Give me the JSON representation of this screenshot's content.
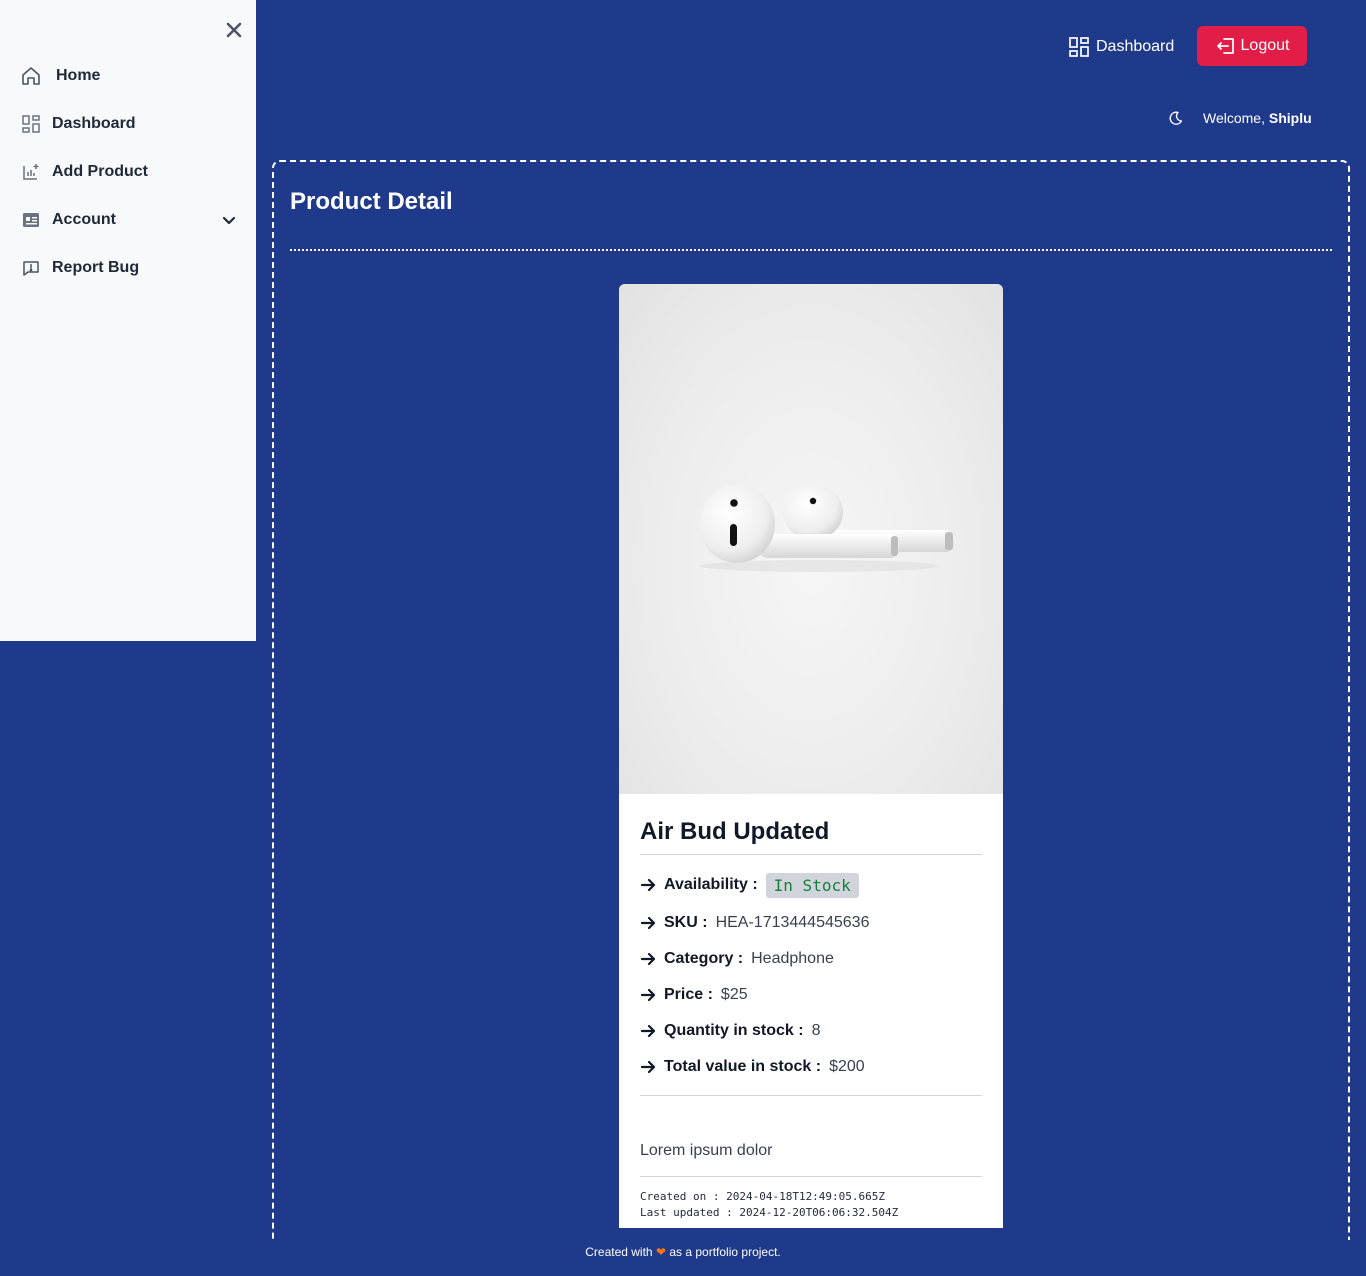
{
  "sidebar": {
    "items": [
      {
        "label": "Home",
        "icon": "home-icon"
      },
      {
        "label": "Dashboard",
        "icon": "grid-icon"
      },
      {
        "label": "Add Product",
        "icon": "add-chart-icon"
      },
      {
        "label": "Account",
        "icon": "account-card-icon"
      },
      {
        "label": "Report Bug",
        "icon": "message-alert-icon"
      }
    ]
  },
  "header": {
    "dashboard_label": "Dashboard",
    "logout_label": "Logout",
    "welcome_prefix": "Welcome,",
    "username": "Shiplu"
  },
  "page": {
    "title": "Product Detail"
  },
  "product": {
    "name": "Air Bud Updated",
    "fields": [
      {
        "label": "Availability :",
        "value": "In Stock"
      },
      {
        "label": "SKU :",
        "value": "HEA-1713444545636"
      },
      {
        "label": "Category :",
        "value": "Headphone"
      },
      {
        "label": "Price :",
        "value": "$25"
      },
      {
        "label": "Quantity in stock :",
        "value": "8"
      },
      {
        "label": "Total value in stock :",
        "value": "$200"
      }
    ],
    "description": "Lorem ipsum dolor",
    "created": "Created on : 2024-04-18T12:49:05.665Z",
    "updated": "Last updated : 2024-12-20T06:06:32.504Z"
  },
  "footer": {
    "prefix": "Created with",
    "suffix": "as a portfolio project."
  },
  "colors": {
    "background": "#1f3a8a",
    "logout": "#e11d48",
    "in_stock": "#15803d"
  }
}
